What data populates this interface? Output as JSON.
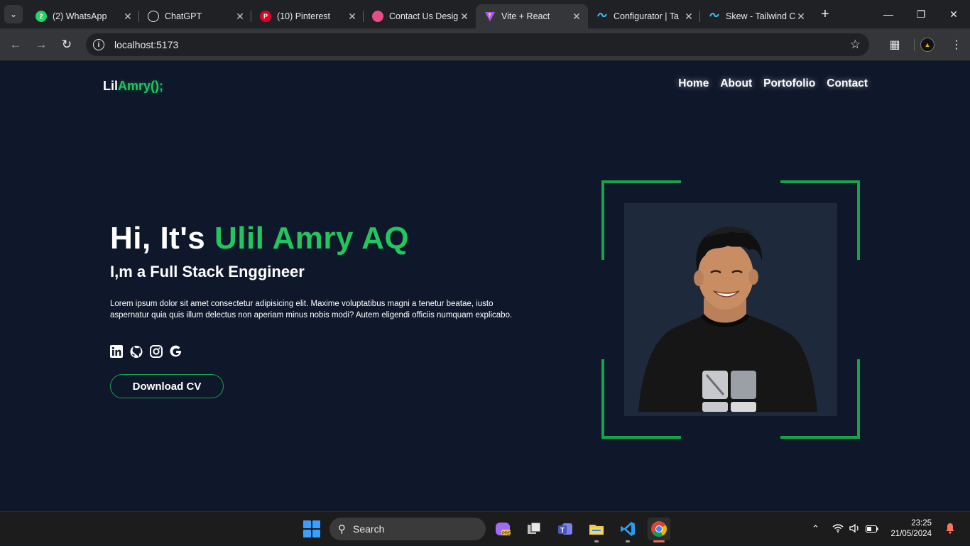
{
  "browser": {
    "tabs": [
      {
        "title": "(2) WhatsApp",
        "icon": "whatsapp-icon",
        "color": "#25d366",
        "badge": "2"
      },
      {
        "title": "ChatGPT",
        "icon": "chatgpt-icon",
        "color": "#e8eaed",
        "badge": ""
      },
      {
        "title": "(10) Pinterest",
        "icon": "pinterest-icon",
        "color": "#e60023",
        "badge": ""
      },
      {
        "title": "Contact Us Desig",
        "icon": "dribbble-icon",
        "color": "#ea4c89",
        "badge": ""
      },
      {
        "title": "Vite + React",
        "icon": "vite-icon",
        "color": "#a855f7",
        "badge": ""
      },
      {
        "title": "Configurator | Ta",
        "icon": "tailwind-icon",
        "color": "#38bdf8",
        "badge": ""
      },
      {
        "title": "Skew - Tailwind C",
        "icon": "tailwind-icon",
        "color": "#38bdf8",
        "badge": ""
      }
    ],
    "active_tab_index": 4,
    "url": "localhost:5173"
  },
  "site": {
    "logo": {
      "part1": "Lil",
      "part2": "Amry();"
    },
    "nav": [
      "Home",
      "About",
      "Portofolio",
      "Contact"
    ],
    "hero": {
      "greeting": "Hi, It's ",
      "name": "Ulil Amry AQ",
      "subtitle": "I,m a Full Stack Enggineer",
      "description": "Lorem ipsum dolor sit amet consectetur adipisicing elit. Maxime voluptatibus magni a tenetur beatae, iusto aspernatur quia quis illum delectus non aperiam minus nobis modi? Autem eligendi officiis numquam explicabo.",
      "socials": [
        "linkedin-icon",
        "github-icon",
        "instagram-icon",
        "google-icon"
      ],
      "cta": "Download CV"
    },
    "colors": {
      "background": "#0f172a",
      "accent": "#22c55e",
      "photo_bg": "#1e293b"
    }
  },
  "taskbar": {
    "search_placeholder": "Search",
    "time": "23:25",
    "date": "21/05/2024"
  }
}
